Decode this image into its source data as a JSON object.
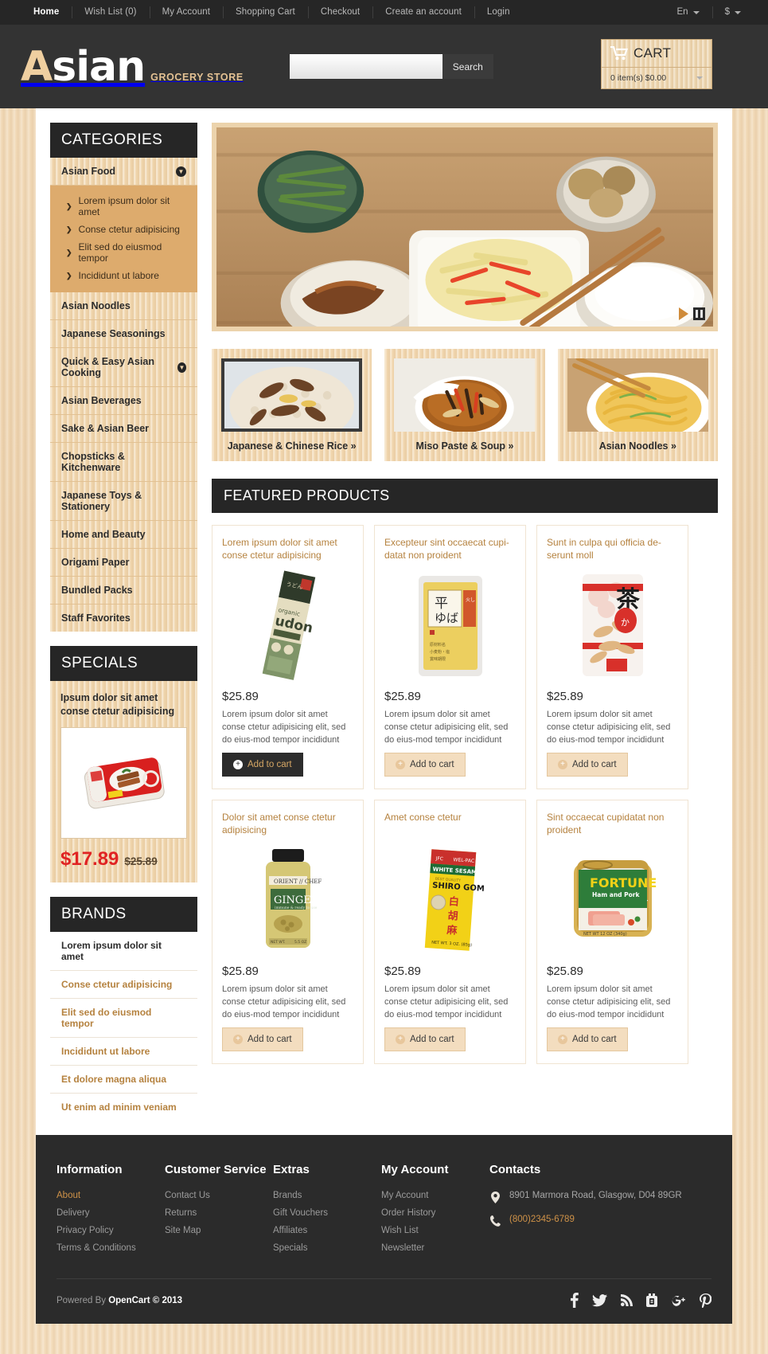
{
  "topbar": {
    "nav": [
      {
        "label": "Home",
        "active": true
      },
      {
        "label": "Wish List (0)",
        "active": false
      },
      {
        "label": "My Account",
        "active": false
      },
      {
        "label": "Shopping Cart",
        "active": false
      },
      {
        "label": "Checkout",
        "active": false
      },
      {
        "label": "Create an account",
        "active": false
      },
      {
        "label": "Login",
        "active": false
      }
    ],
    "language": "En",
    "currency": "$"
  },
  "header": {
    "logo_first": "A",
    "logo_rest": "sian",
    "logo_sub": "GROCERY STORE",
    "search_placeholder": "",
    "search_value": "",
    "search_button": "Search",
    "cart_label": "CART",
    "cart_summary": "0 item(s) $0.00"
  },
  "sidebar": {
    "categories_title": "CATEGORIES",
    "categories": [
      {
        "label": "Asian Food",
        "expandable": true,
        "open": true
      },
      {
        "label": "Asian Noodles",
        "expandable": false,
        "open": false
      },
      {
        "label": "Japanese Seasonings",
        "expandable": false,
        "open": false
      },
      {
        "label": "Quick & Easy Asian Cooking",
        "expandable": true,
        "open": false
      },
      {
        "label": "Asian Beverages",
        "expandable": false,
        "open": false
      },
      {
        "label": "Sake & Asian Beer",
        "expandable": false,
        "open": false
      },
      {
        "label": "Chopsticks & Kitchenware",
        "expandable": false,
        "open": false
      },
      {
        "label": "Japanese Toys & Stationery",
        "expandable": false,
        "open": false
      },
      {
        "label": "Home and Beauty",
        "expandable": false,
        "open": false
      },
      {
        "label": "Origami Paper",
        "expandable": false,
        "open": false
      },
      {
        "label": "Bundled Packs",
        "expandable": false,
        "open": false
      },
      {
        "label": "Staff Favorites",
        "expandable": false,
        "open": false
      }
    ],
    "subcategories": [
      "Lorem ipsum dolor sit amet",
      "Conse ctetur adipisicing",
      "Elit sed do eiusmod tempor",
      "Incididunt ut labore"
    ],
    "specials_title": "SPECIALS",
    "special": {
      "name": "Ipsum dolor sit amet conse ctetur adipisicing",
      "price_new": "$17.89",
      "price_old": "$25.89"
    },
    "brands_title": "BRANDS",
    "brands": [
      "Lorem ipsum dolor sit amet",
      "Conse ctetur adipisicing",
      "Elit sed do eiusmod tempor",
      "Incididunt ut labore",
      "Et dolore magna aliqua",
      "Ut enim ad minim veniam"
    ]
  },
  "tiles": [
    {
      "caption": "Japanese & Chinese Rice »"
    },
    {
      "caption": "Miso Paste & Soup »"
    },
    {
      "caption": "Asian Noodles »"
    }
  ],
  "featured": {
    "title": "FEATURED PRODUCTS",
    "products": [
      {
        "name": "Lorem ipsum dolor sit amet conse ctetur adipisicing",
        "price": "$25.89",
        "description": "Lorem ipsum dolor sit amet conse ctetur adipisicing elit, sed do eius-mod tempor incididunt",
        "button": "Add to cart",
        "highlighted": true,
        "image": "udon-noodles-package"
      },
      {
        "name": "Excepteur sint occaecat cupi-datat non proident",
        "price": "$25.89",
        "description": "Lorem ipsum dolor sit amet conse ctetur adipisicing elit, sed do eius-mod tempor incididunt",
        "button": "Add to cart",
        "highlighted": false,
        "image": "hiraba-noodles-package"
      },
      {
        "name": "Sunt in culpa qui officia de-serunt moll",
        "price": "$25.89",
        "description": "Lorem ipsum dolor sit amet conse ctetur adipisicing elit, sed do eius-mod tempor incididunt",
        "button": "Add to cart",
        "highlighted": false,
        "image": "bonito-flakes-package"
      },
      {
        "name": "Dolor sit amet conse ctetur adipisicing",
        "price": "$25.89",
        "description": "Lorem ipsum dolor sit amet conse ctetur adipisicing elit, sed do eius-mod tempor incididunt",
        "button": "Add to cart",
        "highlighted": false,
        "image": "ginger-jar"
      },
      {
        "name": "Amet conse ctetur",
        "price": "$25.89",
        "description": "Lorem ipsum dolor sit amet conse ctetur adipisicing elit, sed do eius-mod tempor incididunt",
        "button": "Add to cart",
        "highlighted": false,
        "image": "sesame-seeds-box"
      },
      {
        "name": "Sint occaecat cupidatat non proident",
        "price": "$25.89",
        "description": "Lorem ipsum dolor sit amet conse ctetur adipisicing elit, sed do eius-mod tempor incididunt",
        "button": "Add to cart",
        "highlighted": false,
        "image": "luncheon-meat-can"
      }
    ]
  },
  "footer": {
    "columns": [
      {
        "title": "Information",
        "links": [
          {
            "label": "About",
            "highlight": true
          },
          {
            "label": "Delivery",
            "highlight": false
          },
          {
            "label": "Privacy Policy",
            "highlight": false
          },
          {
            "label": "Terms & Conditions",
            "highlight": false
          }
        ]
      },
      {
        "title": "Customer Service",
        "links": [
          {
            "label": "Contact Us",
            "highlight": false
          },
          {
            "label": "Returns",
            "highlight": false
          },
          {
            "label": "Site Map",
            "highlight": false
          }
        ]
      },
      {
        "title": "Extras",
        "links": [
          {
            "label": "Brands",
            "highlight": false
          },
          {
            "label": "Gift Vouchers",
            "highlight": false
          },
          {
            "label": "Affiliates",
            "highlight": false
          },
          {
            "label": "Specials",
            "highlight": false
          }
        ]
      },
      {
        "title": "My Account",
        "links": [
          {
            "label": "My Account",
            "highlight": false
          },
          {
            "label": "Order History",
            "highlight": false
          },
          {
            "label": "Wish List",
            "highlight": false
          },
          {
            "label": "Newsletter",
            "highlight": false
          }
        ]
      }
    ],
    "contacts_title": "Contacts",
    "address": "8901 Marmora Road, Glasgow, D04 89GR",
    "phone": "(800)2345-6789",
    "powered_prefix": "Powered By ",
    "powered_brand": "OpenCart © 2013",
    "socials": [
      "facebook-icon",
      "twitter-icon",
      "rss-icon",
      "youtube-icon",
      "googleplus-icon",
      "pinterest-icon"
    ]
  },
  "colors": {
    "dark": "#262626",
    "accent": "#b5823f",
    "wood": "#f0d5ac",
    "sale_red": "#e02323",
    "subcat_bg": "#ddab6d"
  }
}
